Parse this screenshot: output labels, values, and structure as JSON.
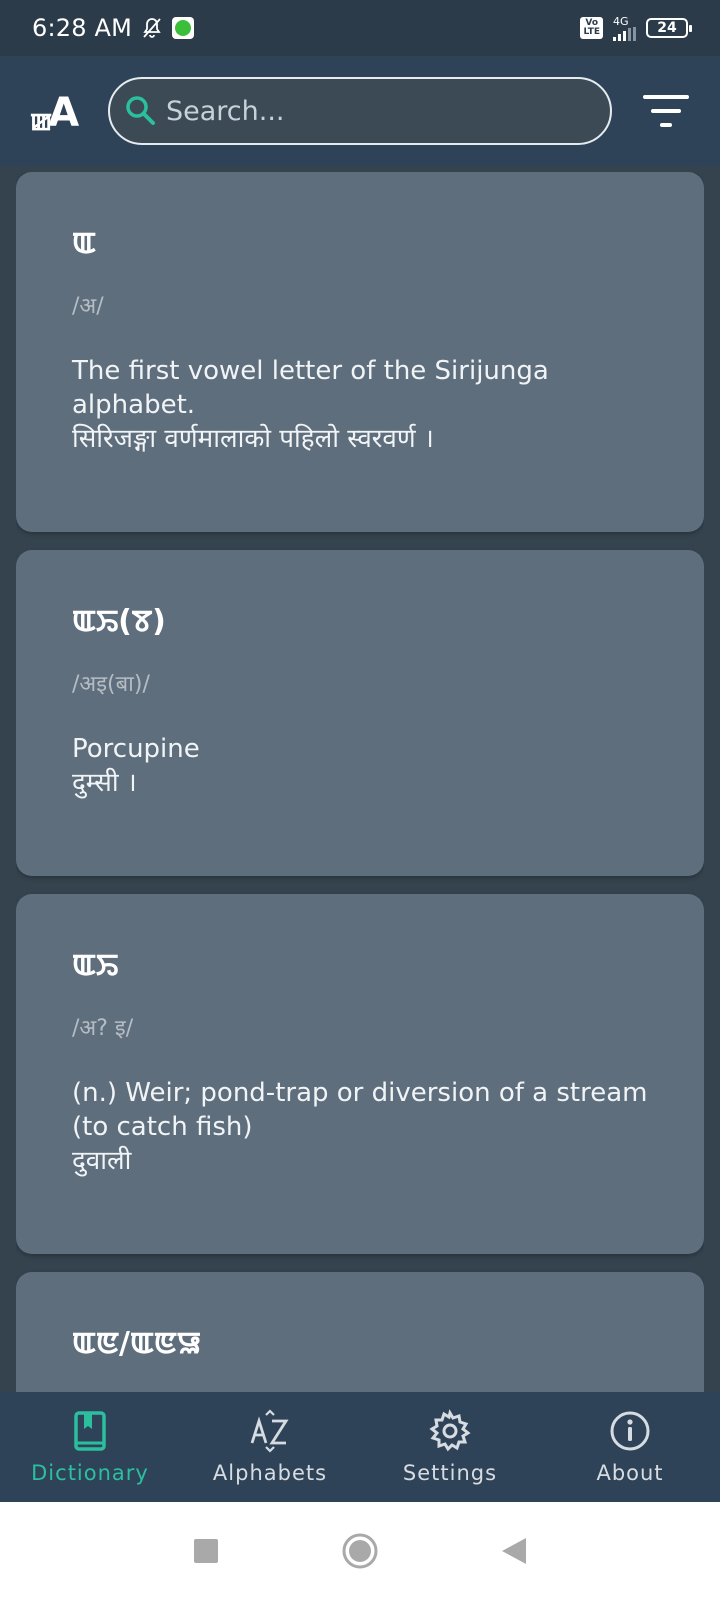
{
  "status_bar": {
    "time": "6:28 AM",
    "network_label": "4G",
    "volte_label": "Vo\nLTE",
    "battery": "24"
  },
  "header": {
    "logo_script": "ꯀ",
    "logo_letter": "A",
    "search_placeholder": "Search..."
  },
  "entries": [
    {
      "word": "ꯑ",
      "pronunciation": "/अ/",
      "meaning_en": "The first vowel letter of the Sirijunga alphabet.",
      "meaning_np": "सिरिजङ्गा वर्णमालाको पहिलो स्वरवर्ण ।"
    },
    {
      "word": "ꯑꯢ(ꯕ)",
      "pronunciation": "/अइ(बा)/",
      "meaning_en": "Porcupine",
      "meaning_np": "दुम्सी ।"
    },
    {
      "word": "ꯑꯢ",
      "pronunciation": "/अ? इ/",
      "meaning_en": "(n.) Weir; pond-trap or diversion of a stream (to catch fish)",
      "meaning_np": "दुवाली"
    },
    {
      "word": "ꯑꯟ/ꯑꯟꯎ",
      "pronunciation": "",
      "meaning_en": "",
      "meaning_np": ""
    }
  ],
  "bottom_nav": {
    "items": [
      {
        "label": "Dictionary",
        "icon": "book-icon",
        "active": true
      },
      {
        "label": "Alphabets",
        "icon": "az-sort-icon",
        "active": false
      },
      {
        "label": "Settings",
        "icon": "gear-icon",
        "active": false
      },
      {
        "label": "About",
        "icon": "info-icon",
        "active": false
      }
    ]
  },
  "colors": {
    "accent": "#2bbfa0",
    "header_bg": "#2f4358",
    "card_bg": "#5f6e7c",
    "page_bg": "#35434f"
  }
}
